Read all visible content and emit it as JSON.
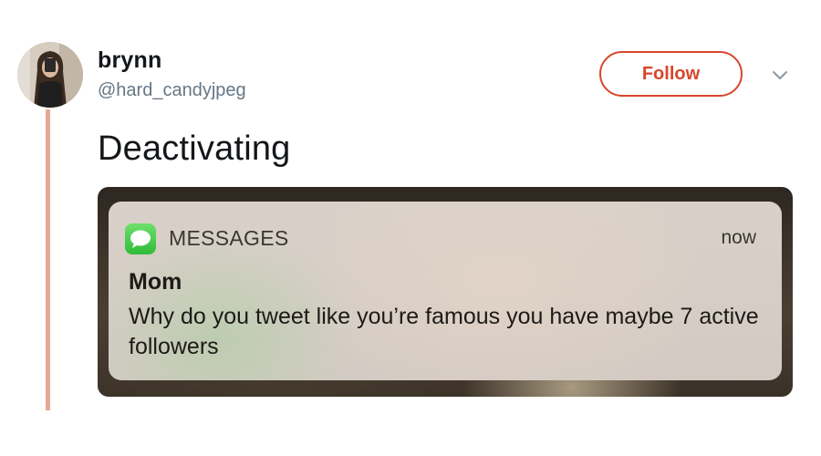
{
  "tweet": {
    "author": {
      "display_name": "brynn",
      "handle": "@hard_candyjpeg"
    },
    "follow_label": "Follow",
    "text": "Deactivating",
    "accent_color": "#d8462b",
    "thread_line_color": "#e6a898"
  },
  "notification": {
    "app_name": "MESSAGES",
    "time": "now",
    "sender": "Mom",
    "body": "Why do you tweet like you’re famous you have maybe 7 active followers",
    "icon": "messages-app-icon"
  }
}
